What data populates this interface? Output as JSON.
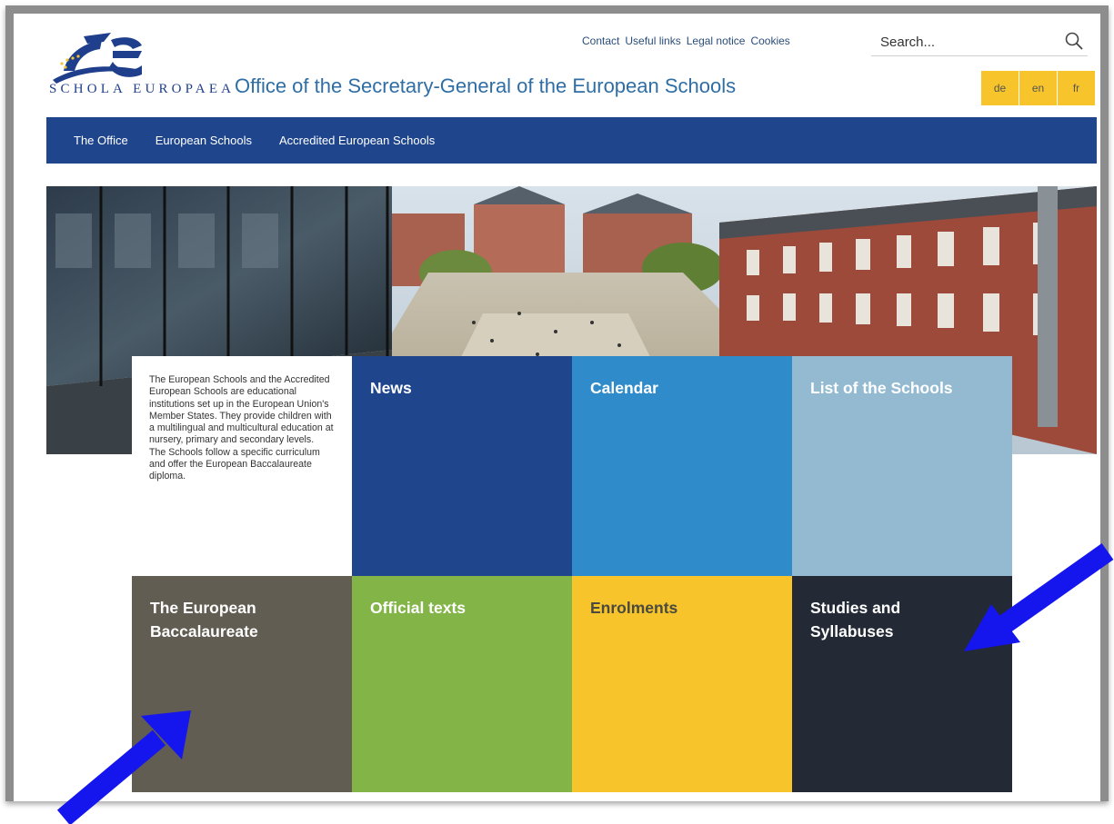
{
  "header": {
    "logo_text": "SCHOLA EUROPAEA",
    "site_title": "Office of the Secretary-General of the European Schools",
    "top_links": [
      "Contact",
      "Useful links",
      "Legal notice",
      "Cookies"
    ],
    "search": {
      "placeholder": "Search..."
    },
    "languages": [
      "de",
      "en",
      "fr"
    ]
  },
  "nav": {
    "items": [
      "The Office",
      "European Schools",
      "Accredited European Schools"
    ]
  },
  "intro": {
    "paragraph1": "The European Schools and the Accredited European Schools are educational institutions set up in the European Union's Member States. They provide children with a multilingual and multicultural education at nursery, primary and secondary levels.",
    "paragraph2": "The Schools follow a specific curriculum and offer the European Baccalaureate diploma."
  },
  "tiles": [
    {
      "label": "News",
      "color": "#1f468c"
    },
    {
      "label": "Calendar",
      "color": "#2f8bc9"
    },
    {
      "label": "List of the Schools",
      "color": "#93bad1"
    },
    {
      "label": "The European Baccalaureate",
      "color": "#625d52"
    },
    {
      "label": "Official texts",
      "color": "#83b447"
    },
    {
      "label": "Enrolments",
      "color": "#f7c42c"
    },
    {
      "label": "Studies and Syllabuses",
      "color": "#232a36"
    }
  ],
  "colors": {
    "brand_blue": "#1f468c",
    "title_blue": "#2f6ea5",
    "lang_yellow": "#f7c42c",
    "arrow_blue": "#1515ee"
  }
}
